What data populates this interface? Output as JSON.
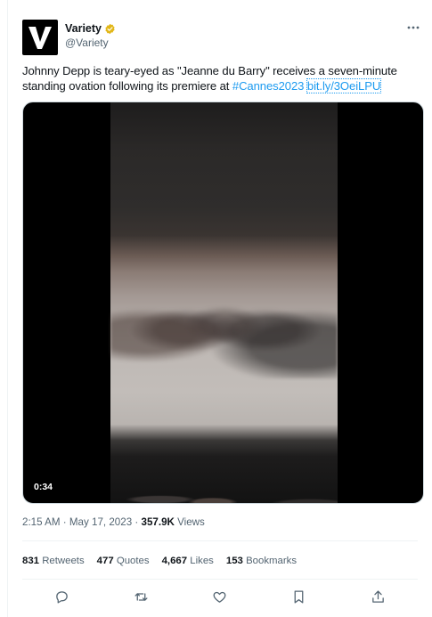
{
  "author": {
    "display_name": "Variety",
    "handle": "@Variety",
    "verified": true,
    "avatar_icon": "variety-v-logo",
    "verified_color": "#e2b719"
  },
  "tweet": {
    "text_part1": "Johnny Depp is teary-eyed as \"Jeanne du Barry\" receives a seven-minute standing ovation following its premiere at ",
    "hashtag": "#Cannes2023",
    "link": "bit.ly/3OeiLPU"
  },
  "media": {
    "duration": "0:34"
  },
  "meta": {
    "time": "2:15 AM",
    "separator": "·",
    "date": "May 17, 2023",
    "views_count": "357.9K",
    "views_label": "Views"
  },
  "stats": [
    {
      "count": "831",
      "label": "Retweets"
    },
    {
      "count": "477",
      "label": "Quotes"
    },
    {
      "count": "4,667",
      "label": "Likes"
    },
    {
      "count": "153",
      "label": "Bookmarks"
    }
  ],
  "actions": [
    "reply-icon",
    "retweet-icon",
    "like-icon",
    "bookmark-icon",
    "share-icon"
  ],
  "colors": {
    "link": "#1d9bf0",
    "secondary_text": "#536471",
    "primary_text": "#0f1419"
  }
}
